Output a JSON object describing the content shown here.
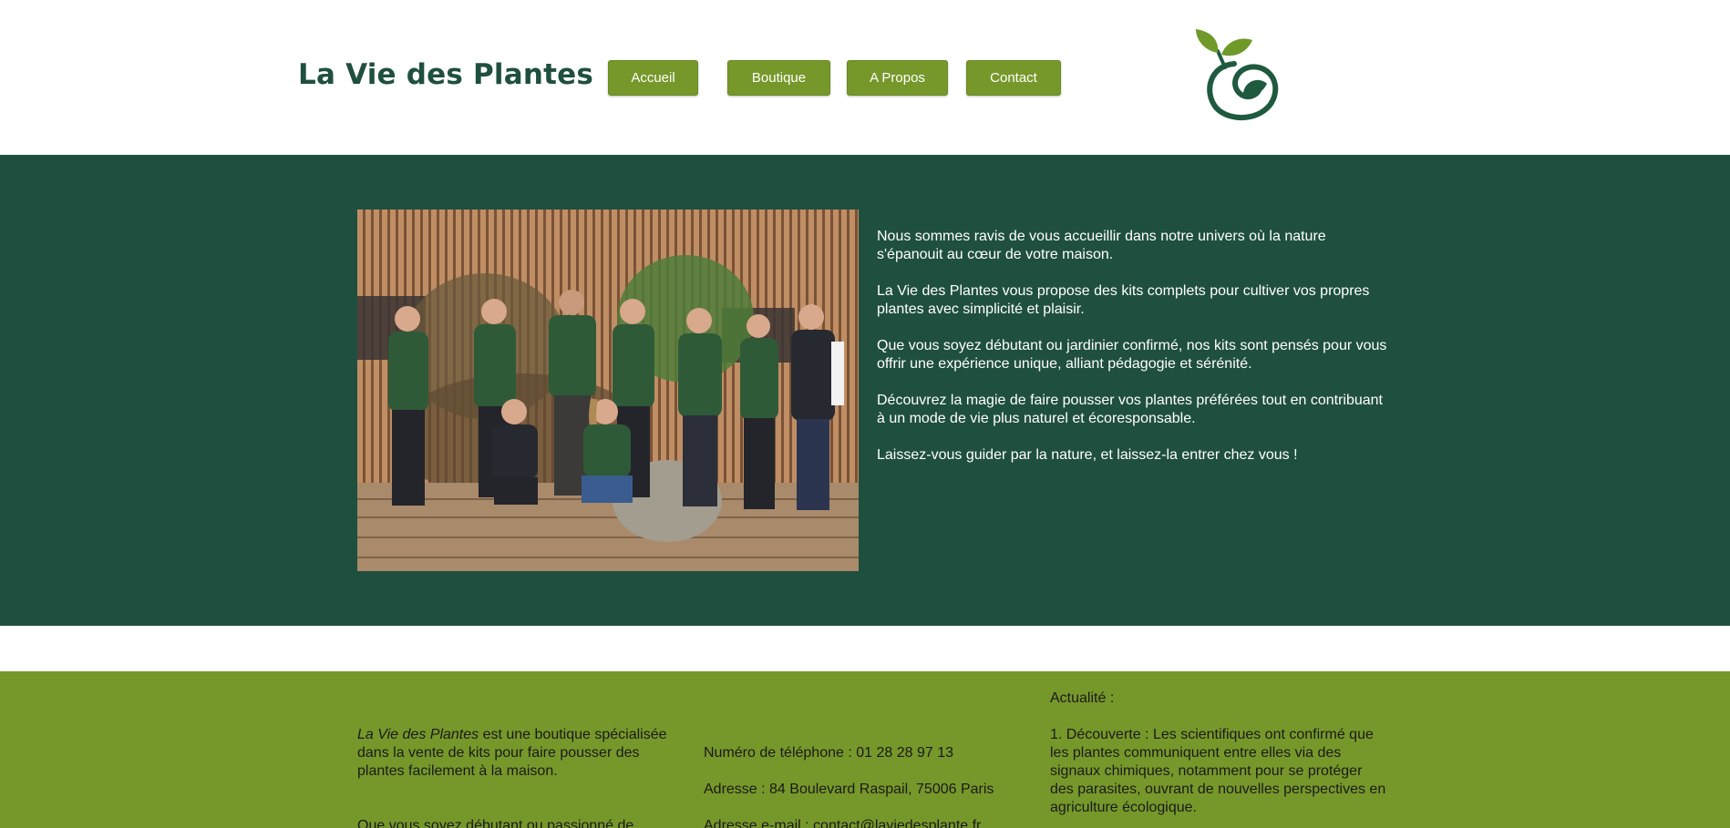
{
  "header": {
    "site_title": "La Vie des Plantes",
    "nav": [
      {
        "label": "Accueil"
      },
      {
        "label": "Boutique"
      },
      {
        "label": "A Propos"
      },
      {
        "label": "Contact"
      }
    ],
    "logo_icon": "sprout-leaf-logo-icon"
  },
  "colors": {
    "dark_green": "#1f4f3f",
    "olive_green": "#76982a",
    "white": "#ffffff"
  },
  "hero": {
    "photo_alt": "team-photo",
    "paragraphs": [
      "Nous sommes ravis de vous accueillir dans notre univers où la nature s'épanouit au cœur de votre maison.",
      "La Vie des Plantes vous propose des kits complets pour cultiver vos propres plantes avec simplicité et plaisir.",
      "Que vous soyez débutant ou jardinier confirmé, nos kits sont pensés pour vous offrir une expérience unique, alliant pédagogie et sérénité.",
      "Découvrez la magie de faire pousser vos plantes préférées tout en contribuant à un mode de vie plus naturel et écoresponsable.",
      "Laissez-vous guider par la nature, et laissez-la entrer chez vous !"
    ]
  },
  "footer": {
    "about_brand": "La Vie des Plantes",
    "about_text": " est une boutique spécialisée dans la vente de kits pour faire pousser des plantes facilement à la maison.",
    "about_text_2": "Que vous soyez débutant ou passionné de",
    "phone": "Numéro de téléphone : 01 28 28 97 13",
    "address": "Adresse : 84 Boulevard Raspail, 75006 Paris",
    "email": "Adresse e-mail : contact@laviedesplante.fr",
    "news_title": "Actualité :",
    "news_item": "1. Découverte : Les scientifiques ont confirmé que les plantes communiquent entre elles via des signaux chimiques, notamment pour se protéger des parasites, ouvrant de nouvelles perspectives en agriculture écologique."
  }
}
